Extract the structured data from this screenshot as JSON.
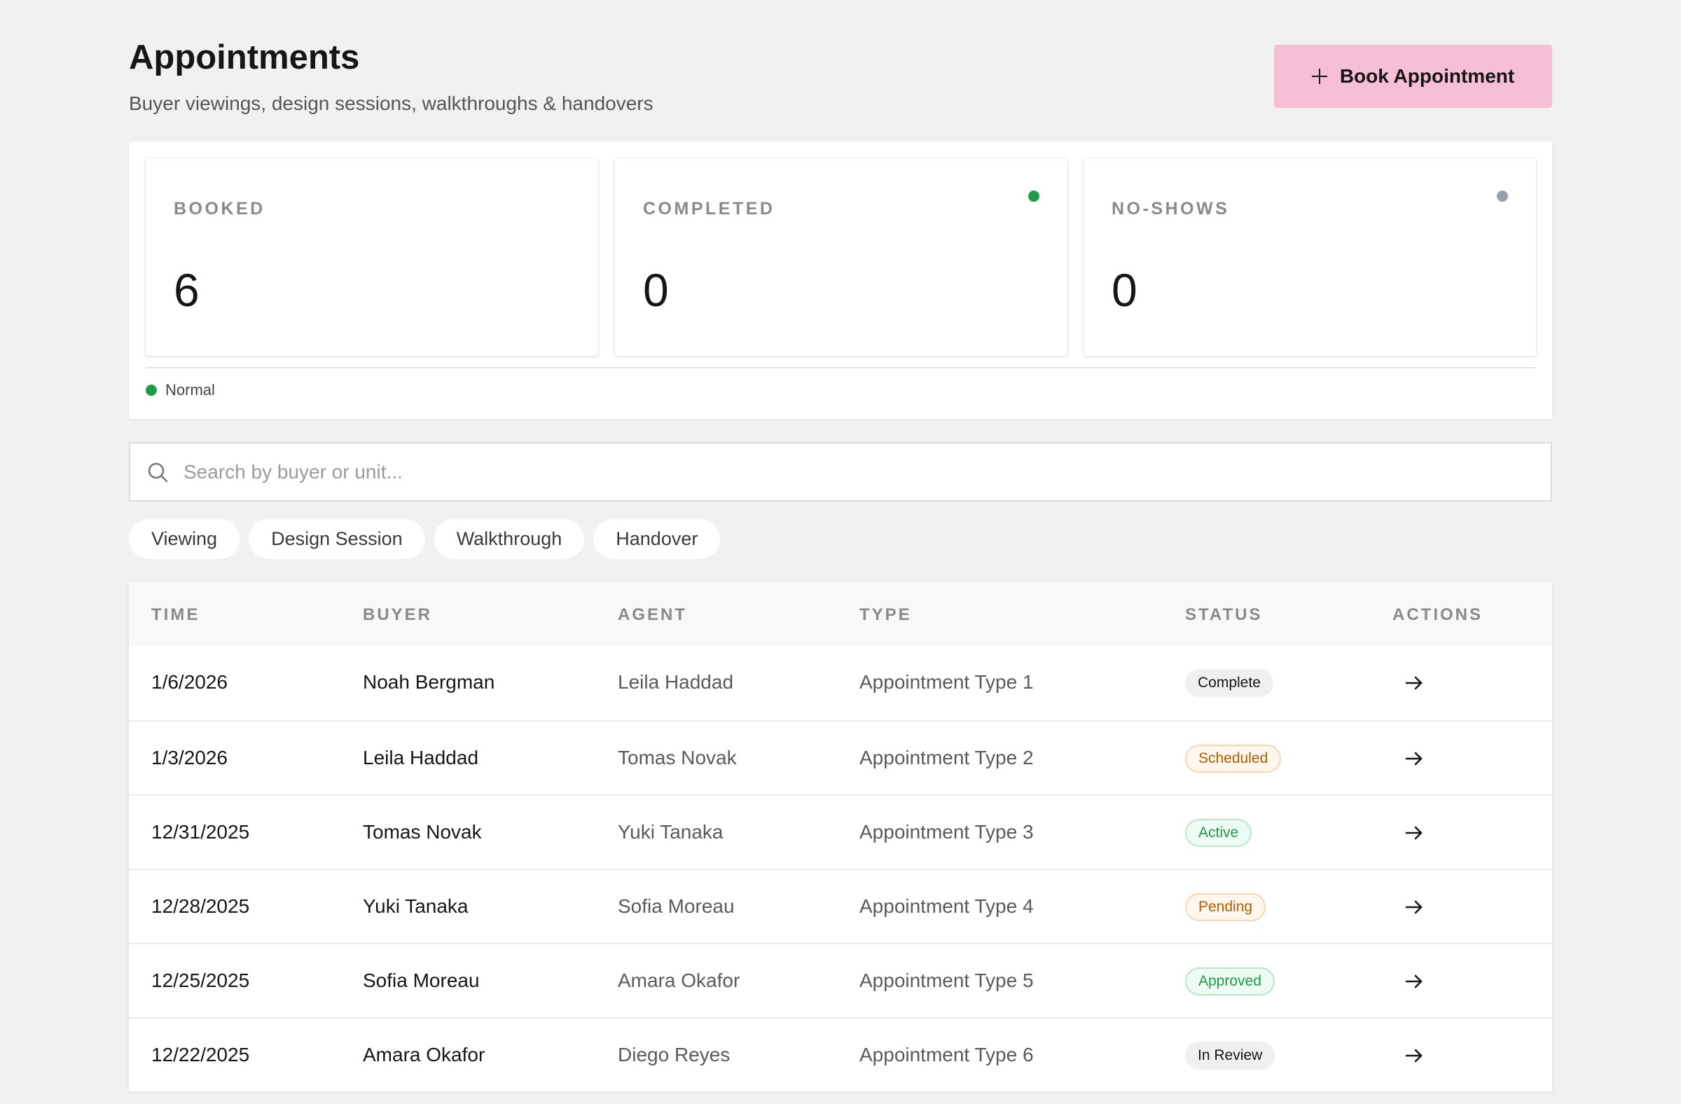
{
  "header": {
    "title": "Appointments",
    "subtitle": "Buyer viewings, design sessions, walkthroughs & handovers",
    "book_button_label": "Book Appointment",
    "book_button_icon": "plus-icon",
    "book_button_color": "#f6bfd6"
  },
  "stats": [
    {
      "label": "BOOKED",
      "value": "6"
    },
    {
      "label": "COMPLETED",
      "value": "0",
      "indicator_color": "#1e9a4a"
    },
    {
      "label": "NO-SHOWS",
      "value": "0",
      "indicator_color": "#9aa0a8"
    }
  ],
  "legend": {
    "label": "Normal",
    "color": "#1e9a4a"
  },
  "search": {
    "placeholder": "Search by buyer or unit...",
    "value": "",
    "icon": "search-icon"
  },
  "filters": [
    "Viewing",
    "Design Session",
    "Walkthrough",
    "Handover"
  ],
  "table": {
    "columns": [
      "TIME",
      "BUYER",
      "AGENT",
      "TYPE",
      "STATUS",
      "ACTIONS"
    ],
    "rows": [
      {
        "time": "1/6/2026",
        "buyer": "Noah Bergman",
        "agent": "Leila Haddad",
        "type": "Appointment Type 1",
        "status": "Complete",
        "status_style": "neutral"
      },
      {
        "time": "1/3/2026",
        "buyer": "Leila Haddad",
        "agent": "Tomas Novak",
        "type": "Appointment Type 2",
        "status": "Scheduled",
        "status_style": "warn"
      },
      {
        "time": "12/31/2025",
        "buyer": "Tomas Novak",
        "agent": "Yuki Tanaka",
        "type": "Appointment Type 3",
        "status": "Active",
        "status_style": "ok"
      },
      {
        "time": "12/28/2025",
        "buyer": "Yuki Tanaka",
        "agent": "Sofia Moreau",
        "type": "Appointment Type 4",
        "status": "Pending",
        "status_style": "warn"
      },
      {
        "time": "12/25/2025",
        "buyer": "Sofia Moreau",
        "agent": "Amara Okafor",
        "type": "Appointment Type 5",
        "status": "Approved",
        "status_style": "ok"
      },
      {
        "time": "12/22/2025",
        "buyer": "Amara Okafor",
        "agent": "Diego Reyes",
        "type": "Appointment Type 6",
        "status": "In Review",
        "status_style": "neutral"
      }
    ],
    "action_icon": "arrow-right-icon"
  }
}
